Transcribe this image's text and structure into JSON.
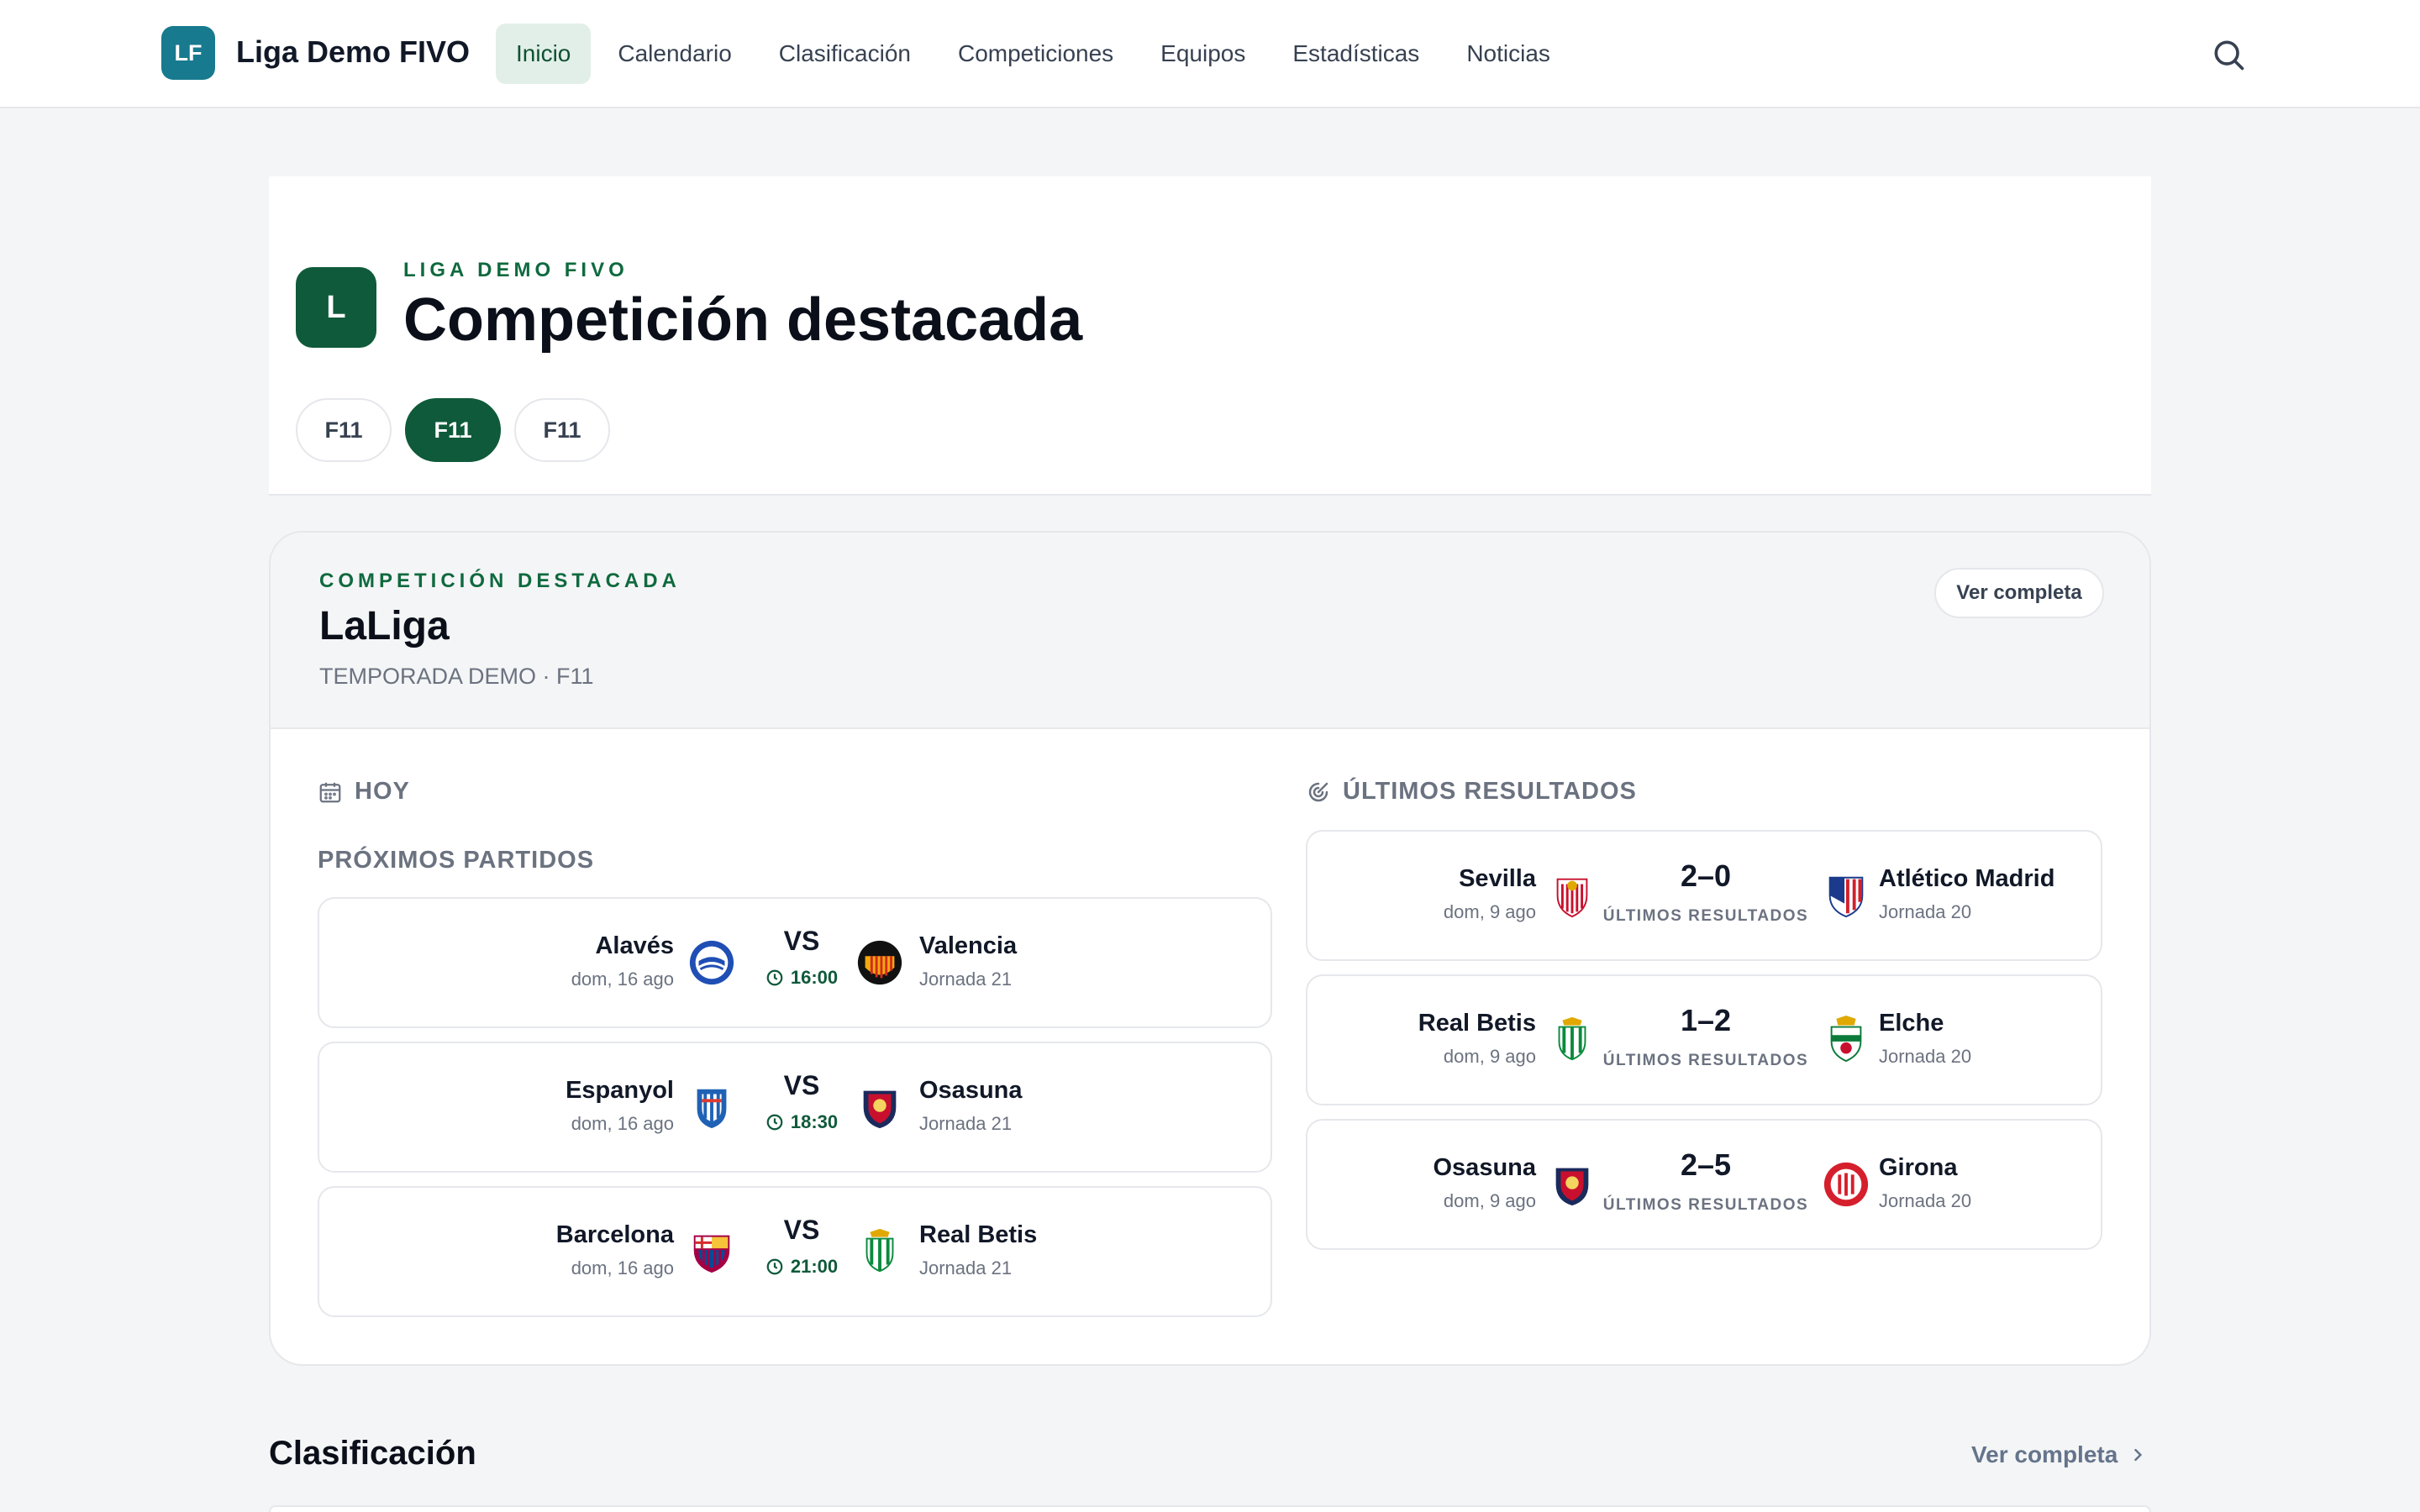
{
  "brand": {
    "badge": "LF",
    "name": "Liga Demo FIVO"
  },
  "nav": {
    "items": [
      "Inicio",
      "Calendario",
      "Clasificación",
      "Competiciones",
      "Equipos",
      "Estadísticas",
      "Noticias"
    ],
    "active": "Inicio"
  },
  "hero": {
    "badge": "L",
    "kicker": "LIGA DEMO FIVO",
    "title": "Competición destacada",
    "chips": [
      "F11",
      "F11",
      "F11"
    ]
  },
  "featured": {
    "kicker": "COMPETICIÓN DESTACADA",
    "title": "LaLiga",
    "subtitle": "TEMPORADA DEMO · F11",
    "button": "Ver completa",
    "today_label": "HOY",
    "upcoming_label": "PRÓXIMOS PARTIDOS",
    "results_label": "ÚLTIMOS RESULTADOS",
    "upcoming": [
      {
        "home": "Alavés",
        "home_meta": "dom, 16 ago",
        "vs": "VS",
        "time": "16:00",
        "away": "Valencia",
        "away_meta": "Jornada 21"
      },
      {
        "home": "Espanyol",
        "home_meta": "dom, 16 ago",
        "vs": "VS",
        "time": "18:30",
        "away": "Osasuna",
        "away_meta": "Jornada 21"
      },
      {
        "home": "Barcelona",
        "home_meta": "dom, 16 ago",
        "vs": "VS",
        "time": "21:00",
        "away": "Real Betis",
        "away_meta": "Jornada 21"
      }
    ],
    "results": [
      {
        "home": "Sevilla",
        "home_meta": "dom, 9 ago",
        "score": "2–0",
        "label": "ÚLTIMOS RESULTADOS",
        "away": "Atlético Madrid",
        "away_meta": "Jornada 20"
      },
      {
        "home": "Real Betis",
        "home_meta": "dom, 9 ago",
        "score": "1–2",
        "label": "ÚLTIMOS RESULTADOS",
        "away": "Elche",
        "away_meta": "Jornada 20"
      },
      {
        "home": "Osasuna",
        "home_meta": "dom, 9 ago",
        "score": "2–5",
        "label": "ÚLTIMOS RESULTADOS",
        "away": "Girona",
        "away_meta": "Jornada 20"
      }
    ]
  },
  "standings": {
    "title": "Clasificación",
    "link": "Ver completa"
  },
  "colors": {
    "brand": "#177a8f",
    "accent": "#0f5a3a",
    "muted": "#6b7280"
  },
  "icons": [
    "search-icon",
    "calendar-icon",
    "results-icon",
    "clock-icon",
    "chevron-right-icon"
  ]
}
